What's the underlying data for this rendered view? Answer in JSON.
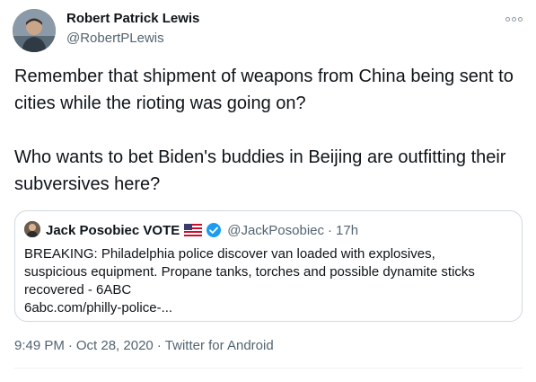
{
  "author": {
    "name": "Robert Patrick Lewis",
    "handle": "@RobertPLewis"
  },
  "tweet": {
    "paragraphs": [
      "Remember that shipment of weapons from China being sent to cities while the rioting was going on?",
      "Who wants to bet Biden's buddies in Beijing are outfitting their subversives here?"
    ]
  },
  "quoted": {
    "name": "Jack Posobiec VOTE",
    "flag_icon": "us-flag-icon",
    "verified_icon": "verified-badge-icon",
    "handle": "@JackPosobiec",
    "separator": "·",
    "time": "17h",
    "lines": [
      "BREAKING: Philadelphia police discover van loaded with explosives,",
      "suspicious equipment. Propane tanks, torches and possible dynamite sticks",
      "recovered - 6ABC",
      "6abc.com/philly-police-..."
    ]
  },
  "meta": {
    "time": "9:49 PM",
    "sep1": "·",
    "date": "Oct 28, 2020",
    "sep2": "·",
    "source": "Twitter for Android"
  },
  "colors": {
    "text": "#0f1419",
    "secondary": "#536471",
    "border": "#cfd9de",
    "verified": "#1d9bf0"
  }
}
